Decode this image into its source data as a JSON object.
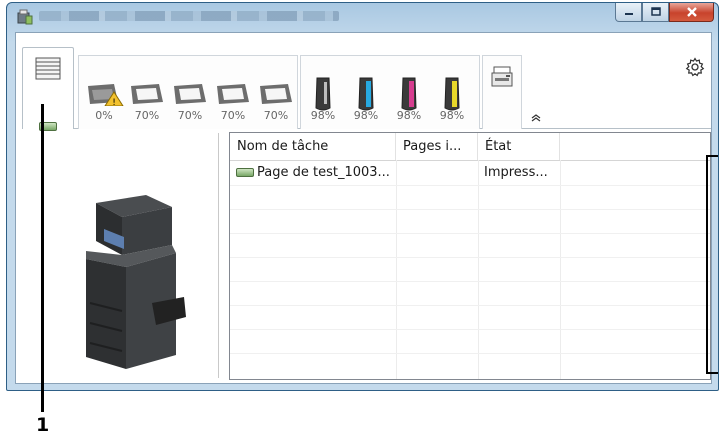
{
  "window": {
    "title": "",
    "controls": {
      "minimize_icon": "minimize-icon",
      "maximize_icon": "maximize-icon",
      "close_icon": "close-icon"
    }
  },
  "toolbar": {
    "print_queue_tab": {
      "icon": "print-queue-icon",
      "status_icon": "printing-indicator-icon"
    },
    "paper_trays": [
      {
        "icon": "tray-warning-icon",
        "level": "0%",
        "warning": true
      },
      {
        "icon": "tray-icon",
        "level": "70%"
      },
      {
        "icon": "tray-icon",
        "level": "70%"
      },
      {
        "icon": "tray-icon",
        "level": "70%"
      },
      {
        "icon": "tray-icon",
        "level": "70%"
      }
    ],
    "toners": [
      {
        "color": "#3a3a3a",
        "level": "98%"
      },
      {
        "color": "#27a9e1",
        "level": "98%"
      },
      {
        "color": "#d63d8f",
        "level": "98%"
      },
      {
        "color": "#e8d82a",
        "level": "98%"
      }
    ],
    "device_icon": "mfp-device-icon",
    "expand_icon": "double-chevron-up-icon",
    "settings_icon": "gear-icon"
  },
  "job_list": {
    "columns": [
      "Nom de tâche",
      "Pages i...",
      "État"
    ],
    "rows": [
      {
        "name": "Page de test_1003...",
        "pages": "",
        "status": "Impress..."
      }
    ]
  },
  "callout": {
    "label": "1"
  },
  "colors": {
    "accent": "#2e5f86",
    "job_indicator": "#78a766"
  }
}
